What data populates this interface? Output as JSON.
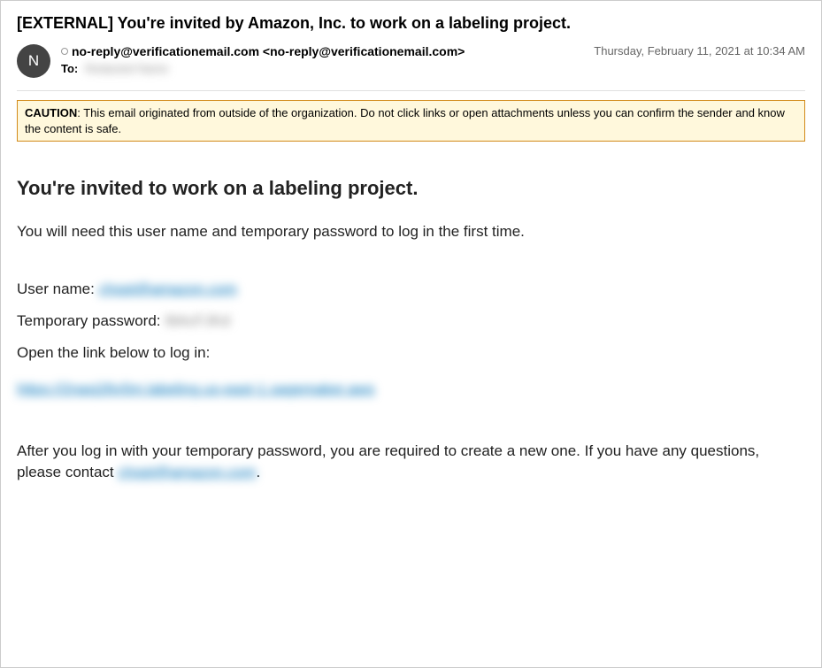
{
  "email": {
    "subject": "[EXTERNAL] You're invited by Amazon, Inc. to work on a labeling project.",
    "avatar_initial": "N",
    "sender_display": "no-reply@verificationemail.com <no-reply@verificationemail.com>",
    "to_label": "To:",
    "to_recipient_masked": "Redacted Name",
    "timestamp": "Thursday, February 11, 2021 at 10:34 AM"
  },
  "caution": {
    "label": "CAUTION",
    "text": ": This email originated from outside of the organization. Do not click links or open attachments unless you can confirm the sender and know the content is safe."
  },
  "body": {
    "heading": "You're invited to work on a labeling project.",
    "intro": "You will need this user name and temporary password to log in the first time.",
    "username_label": "User name: ",
    "username_value_masked": "chopt@amazon.com",
    "password_label": "Temporary password: ",
    "password_value_masked": "9tAcFJKd",
    "open_link_label": "Open the link below to log in:",
    "login_link_masked": "https://2nasj26v5m.labeling.us-east-1.sagemaker.aws",
    "after_text_part1": "After you log in with your temporary password, you are required to create a new one. If you have any questions, please contact ",
    "contact_email_masked": "chopt@amazon.com",
    "after_text_part2": "."
  }
}
